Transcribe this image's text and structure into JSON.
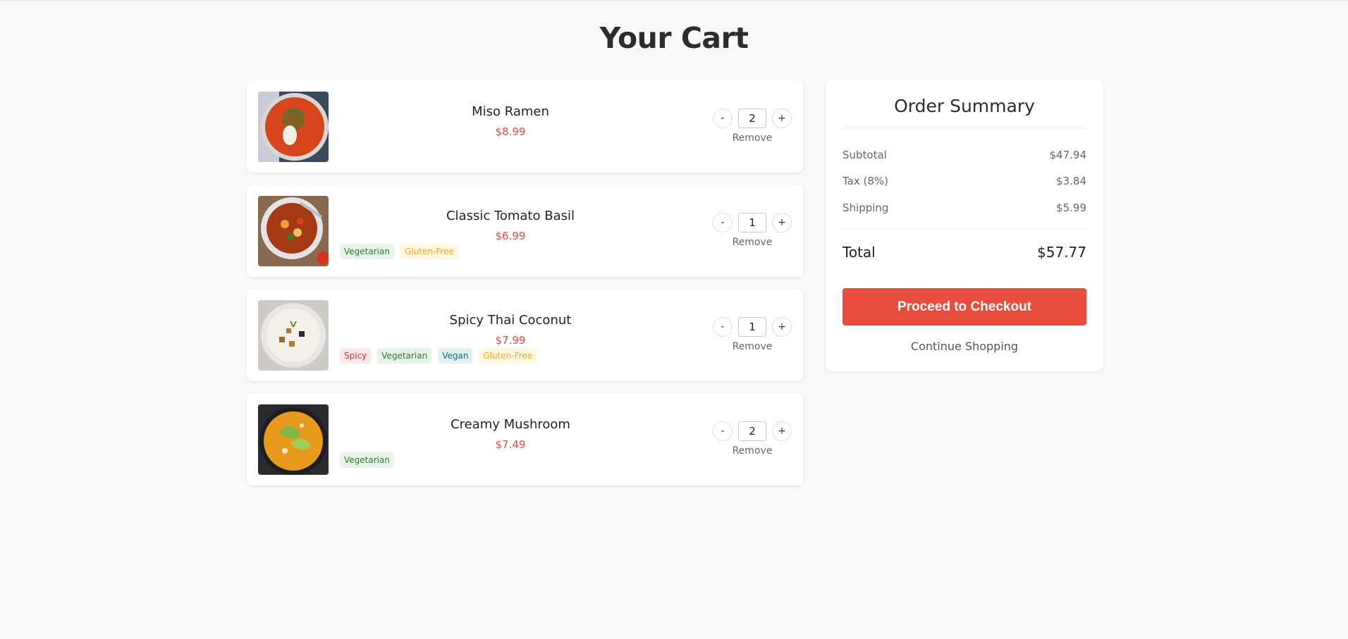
{
  "page": {
    "title": "Your Cart"
  },
  "cart": {
    "items": [
      {
        "name": "Miso Ramen",
        "price": "$8.99",
        "quantity": "2",
        "remove_label": "Remove",
        "tags": [],
        "image": "tomato-soup-bowl-image"
      },
      {
        "name": "Classic Tomato Basil",
        "price": "$6.99",
        "quantity": "1",
        "remove_label": "Remove",
        "tags": [
          {
            "label": "Vegetarian",
            "kind": "veg"
          },
          {
            "label": "Gluten-Free",
            "kind": "gf"
          }
        ],
        "image": "vegetable-soup-bowl-image"
      },
      {
        "name": "Spicy Thai Coconut",
        "price": "$7.99",
        "quantity": "1",
        "remove_label": "Remove",
        "tags": [
          {
            "label": "Spicy",
            "kind": "spicy"
          },
          {
            "label": "Vegetarian",
            "kind": "veg"
          },
          {
            "label": "Vegan",
            "kind": "vegan"
          },
          {
            "label": "Gluten-Free",
            "kind": "gf"
          }
        ],
        "image": "cream-soup-bowl-image"
      },
      {
        "name": "Creamy Mushroom",
        "price": "$7.49",
        "quantity": "2",
        "remove_label": "Remove",
        "tags": [
          {
            "label": "Vegetarian",
            "kind": "veg"
          }
        ],
        "image": "squash-soup-bowl-image"
      }
    ],
    "decrement_label": "-",
    "increment_label": "+"
  },
  "summary": {
    "title": "Order Summary",
    "subtotal_label": "Subtotal",
    "subtotal_value": "$47.94",
    "tax_label": "Tax (8%)",
    "tax_value": "$3.84",
    "shipping_label": "Shipping",
    "shipping_value": "$5.99",
    "total_label": "Total",
    "total_value": "$57.77",
    "checkout_label": "Proceed to Checkout",
    "continue_label": "Continue Shopping"
  },
  "colors": {
    "accent": "#e74c3c",
    "background": "#f8f9fa"
  }
}
